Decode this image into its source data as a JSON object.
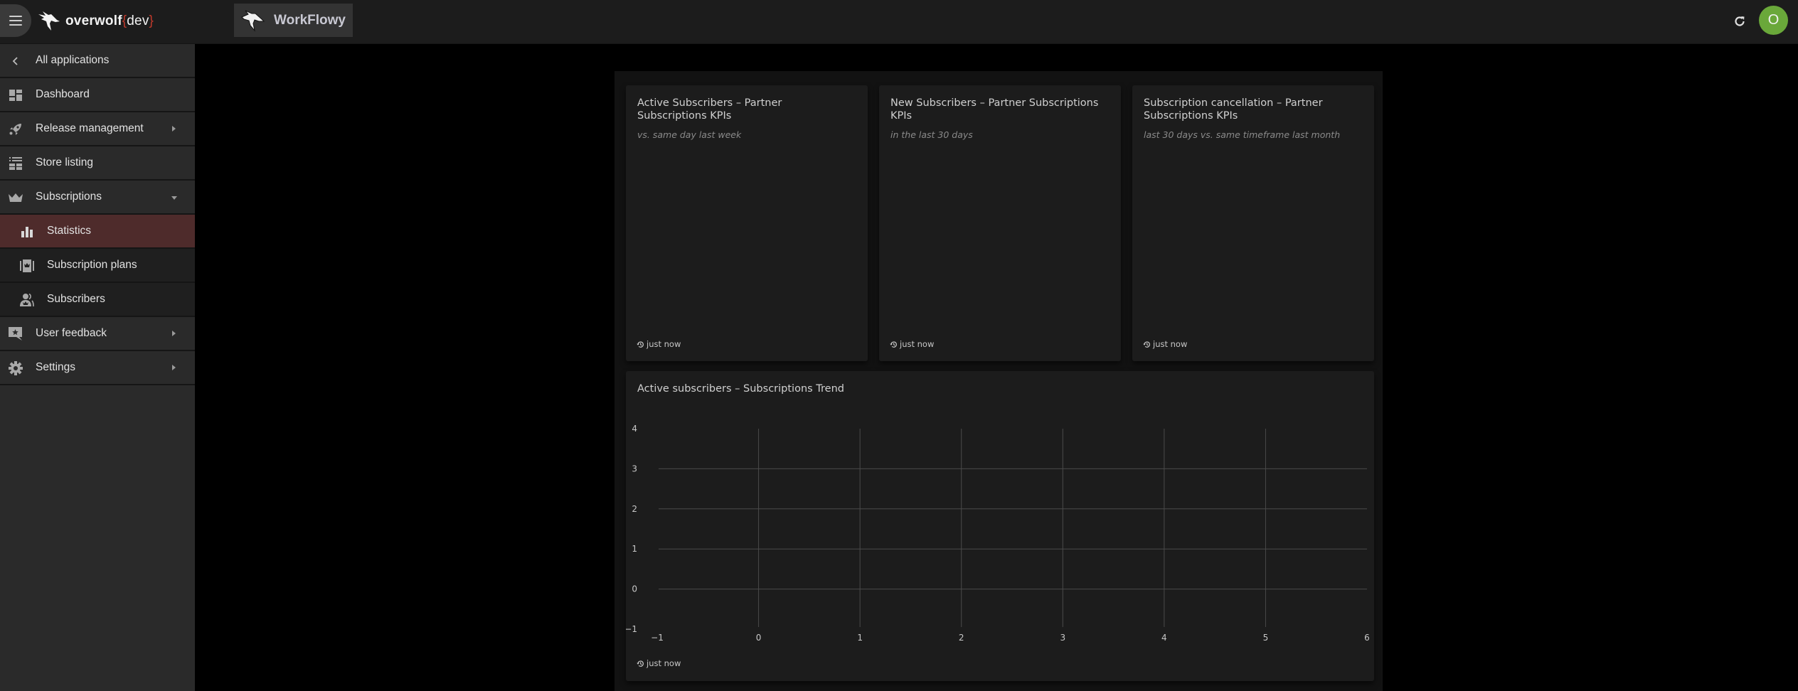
{
  "topbar": {
    "brand_name": "overwolf",
    "brand_suffix_open": "{",
    "brand_suffix": "dev",
    "brand_suffix_close": "}",
    "app_name": "WorkFlowy",
    "refresh_icon": "refresh-icon",
    "avatar_initial": "O",
    "avatar_color": "#6aa83a"
  },
  "sidebar": {
    "back_label": "All applications",
    "items": [
      {
        "label": "Dashboard",
        "icon": "dashboard-icon"
      },
      {
        "label": "Release management",
        "icon": "rocket-icon",
        "caret": "right"
      },
      {
        "label": "Store listing",
        "icon": "store-listing-icon"
      },
      {
        "label": "Subscriptions",
        "icon": "crown-icon",
        "caret": "down",
        "expanded": true
      },
      {
        "label": "Statistics",
        "icon": "bar-chart-icon",
        "active": true,
        "sub": true
      },
      {
        "label": "Subscription plans",
        "icon": "subscription-plans-icon",
        "sub": true
      },
      {
        "label": "Subscribers",
        "icon": "subscribers-icon",
        "sub": true
      },
      {
        "label": "User feedback",
        "icon": "feedback-icon",
        "caret": "right"
      },
      {
        "label": "Settings",
        "icon": "gear-icon",
        "caret": "right"
      }
    ],
    "active_color": "#4e2b2b"
  },
  "kpi_cards": [
    {
      "title": "Active Subscribers – Partner Subscriptions KPIs",
      "subtitle": "vs. same day last week",
      "updated": "just now"
    },
    {
      "title": "New Subscribers – Partner Subscriptions KPIs",
      "subtitle": "in the last 30 days",
      "updated": "just now"
    },
    {
      "title": "Subscription cancellation – Partner Subscriptions KPIs",
      "subtitle": "last 30 days vs. same timeframe last month",
      "updated": "just now"
    }
  ],
  "trend_card": {
    "title": "Active subscribers – Subscriptions Trend",
    "updated": "just now"
  },
  "chart_data": {
    "type": "line",
    "title": "Active subscribers – Subscriptions Trend",
    "xlabel": "",
    "ylabel": "",
    "series": [],
    "x_ticks": [
      -1,
      0,
      1,
      2,
      3,
      4,
      5,
      6
    ],
    "y_ticks": [
      -1,
      0,
      1,
      2,
      3,
      4
    ],
    "xlim": [
      -1,
      6
    ],
    "ylim": [
      -1,
      4
    ],
    "grid": true,
    "legend": "none"
  }
}
